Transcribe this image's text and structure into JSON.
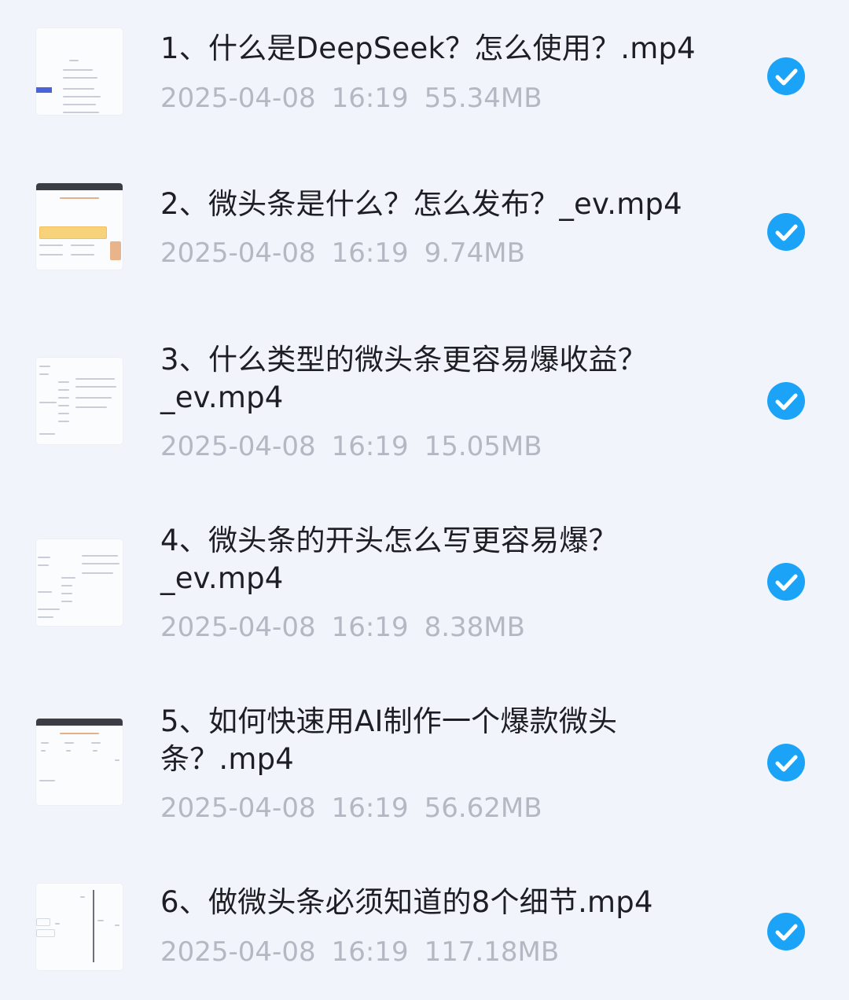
{
  "files": [
    {
      "name": "1、什么是DeepSeek？怎么使用？.mp4",
      "date": "2025-04-08",
      "time": "16:19",
      "size": "55.34MB",
      "selected": true,
      "thumb": "mindmap-blue"
    },
    {
      "name": "2、微头条是什么？怎么发布？_ev.mp4",
      "date": "2025-04-08",
      "time": "16:19",
      "size": "9.74MB",
      "selected": true,
      "thumb": "browser-banner"
    },
    {
      "name": "3、什么类型的微头条更容易爆收益？_ev.mp4",
      "date": "2025-04-08",
      "time": "16:19",
      "size": "15.05MB",
      "selected": true,
      "thumb": "mindmap"
    },
    {
      "name": "4、微头条的开头怎么写更容易爆？_ev.mp4",
      "date": "2025-04-08",
      "time": "16:19",
      "size": "8.38MB",
      "selected": true,
      "thumb": "mindmap"
    },
    {
      "name": "5、如何快速用AI制作一个爆款微头条？.mp4",
      "date": "2025-04-08",
      "time": "16:19",
      "size": "56.62MB",
      "selected": true,
      "thumb": "browser"
    },
    {
      "name": "6、做微头条必须知道的8个细节.mp4",
      "date": "2025-04-08",
      "time": "16:19",
      "size": "117.18MB",
      "selected": true,
      "thumb": "mindmap-line"
    }
  ],
  "colors": {
    "check": "#1aa3f7",
    "background": "#f1f4fa",
    "meta_text": "#b3b8c2"
  },
  "icons": {
    "selected": "checkmark-circle-icon"
  }
}
